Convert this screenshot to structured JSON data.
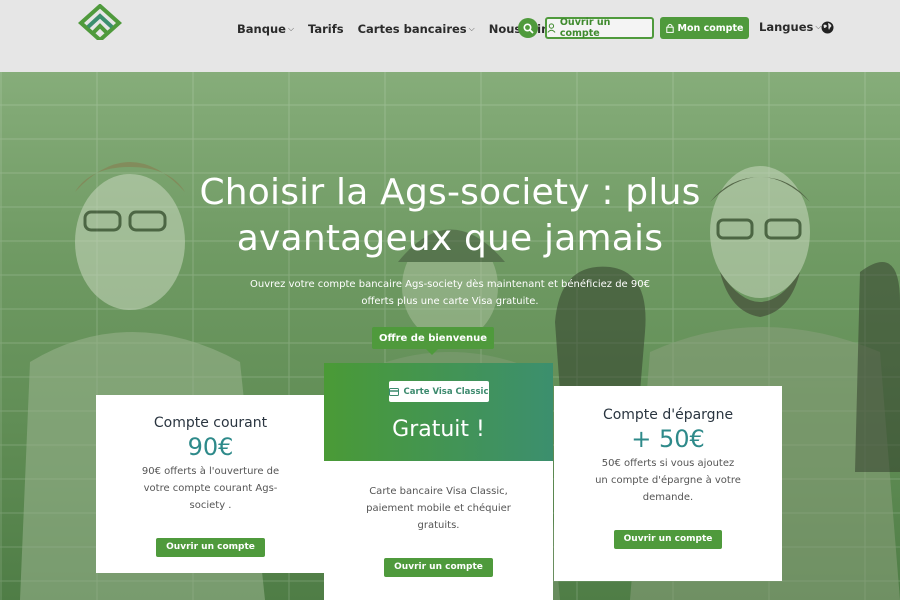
{
  "header": {
    "nav": [
      {
        "label": "Banque",
        "has_caret": true
      },
      {
        "label": "Tarifs",
        "has_caret": false
      },
      {
        "label": "Cartes bancaires",
        "has_caret": true
      },
      {
        "label": "Nous joindre",
        "has_caret": false
      }
    ],
    "open_account_label": "Ouvrir un compte",
    "my_account_label": "Mon compte",
    "languages_label": "Langues",
    "caret": "⌵",
    "accent_color": "#4f9a3c"
  },
  "hero": {
    "title": "Choisir la Ags-society : plus avantageux que jamais",
    "subtitle": "Ouvrez votre compte bancaire Ags-society dès maintenant et bénéficiez de 90€ offerts plus une carte Visa gratuite.",
    "welcome_tag": "Offre de bienvenue"
  },
  "cards": {
    "current": {
      "title": "Compte courant",
      "amount": "90€",
      "description": "90€ offerts à l'ouverture de votre compte courant Ags-society .",
      "button": "Ouvrir un compte"
    },
    "visa": {
      "badge": "Carte Visa Classic",
      "headline": "Gratuit !",
      "description": "Carte bancaire Visa Classic, paiement mobile et chéquier gratuits.",
      "button": "Ouvrir un compte"
    },
    "savings": {
      "title": "Compte d'épargne",
      "amount": "+ 50€",
      "description": "50€ offerts si vous ajoutez un compte d'épargne à votre demande.",
      "button": "Ouvrir un compte"
    }
  },
  "icons": {
    "logo": "logo-icon",
    "search": "search-icon",
    "user": "user-icon",
    "lock": "lock-icon",
    "globe": "globe-icon",
    "card": "credit-card-icon"
  }
}
